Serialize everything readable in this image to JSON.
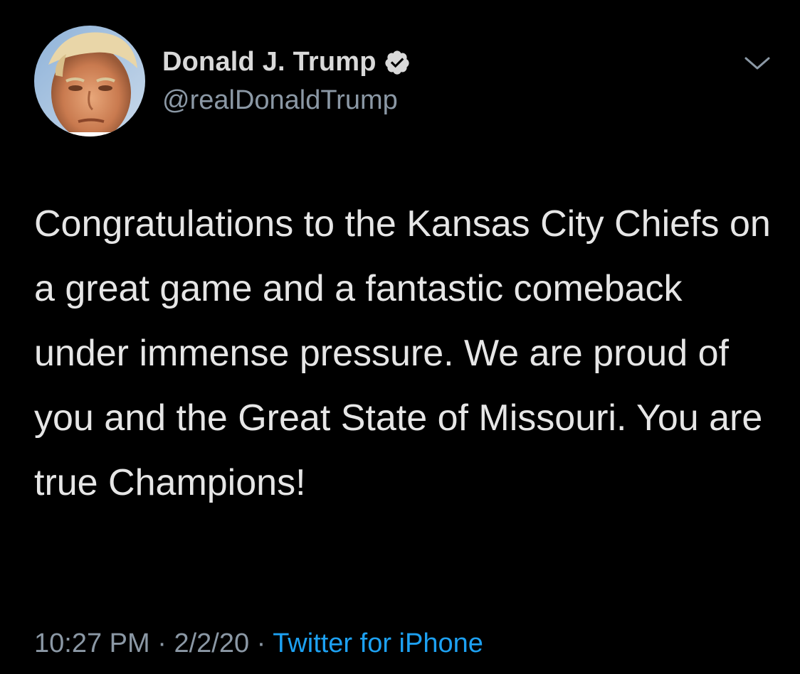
{
  "author": {
    "display_name": "Donald J. Trump",
    "handle": "@realDonaldTrump",
    "verified": true,
    "verified_icon": "verified-badge-icon"
  },
  "tweet": {
    "text": "Congratulations to the Kansas City Chiefs on a great game and a fantastic comeback under immense pressure. We are proud of you and the Great State of Missouri. You are true Champions!",
    "time": "10:27 PM",
    "separator": "·",
    "date": "2/2/20",
    "source": "Twitter for iPhone"
  },
  "icons": {
    "menu": "chevron-down-icon"
  },
  "colors": {
    "background": "#000000",
    "text": "#e6e6e6",
    "secondary_text": "#8b98a5",
    "link": "#1da1f2"
  }
}
